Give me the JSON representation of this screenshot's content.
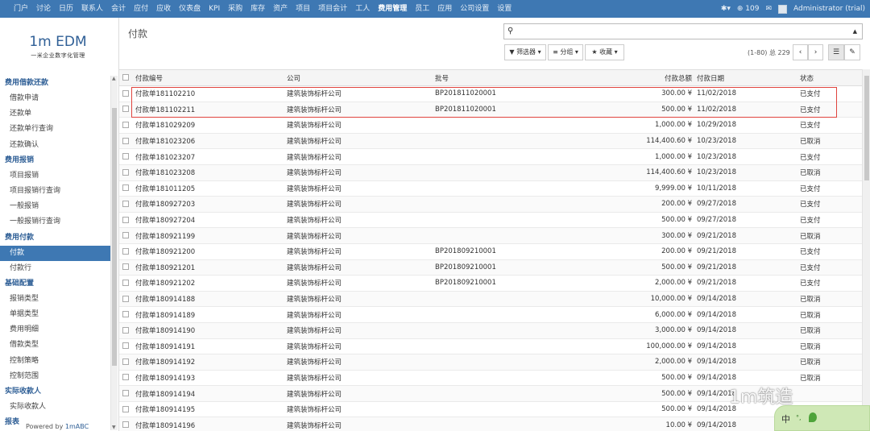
{
  "topnav": {
    "items": [
      "门户",
      "讨论",
      "日历",
      "联系人",
      "会计",
      "应付",
      "应收",
      "仪表盘",
      "KPI",
      "采购",
      "库存",
      "资产",
      "项目",
      "项目会计",
      "工人",
      "费用管理",
      "员工",
      "应用",
      "公司设置",
      "设置"
    ],
    "active": "费用管理"
  },
  "topright": {
    "bug_icon": "bug-icon",
    "count": "109",
    "user": "Administrator (trial)"
  },
  "logo": {
    "main": "1m EDM",
    "sub": "一米企业数字化管理"
  },
  "sidebar": {
    "sections": [
      {
        "title": "费用借款还款",
        "items": [
          "借款申请",
          "还款单",
          "还款单行查询",
          "还款确认"
        ]
      },
      {
        "title": "费用报销",
        "items": [
          "项目报销",
          "项目报销行查询",
          "一般报销",
          "一般报销行查询"
        ]
      },
      {
        "title": "费用付款",
        "items": [
          "付款",
          "付款行"
        ]
      },
      {
        "title": "基础配置",
        "items": [
          "报销类型",
          "单据类型",
          "费用明细",
          "借款类型",
          "控制策略",
          "控制范围"
        ]
      },
      {
        "title": "实际收款人",
        "items": [
          "实际收款人"
        ]
      },
      {
        "title": "报表",
        "items": []
      }
    ],
    "active_item": "付款",
    "powered_prefix": "Powered by ",
    "powered_brand": "1mABC"
  },
  "page": {
    "title": "付款",
    "filters_label": "筛选器",
    "group_label": "分组",
    "favorites_label": "收藏",
    "pager_text": "(1-80) 总 229",
    "prev": "‹",
    "next": "›"
  },
  "table": {
    "headers": [
      "付款编号",
      "公司",
      "批号",
      "付款总额",
      "付款日期",
      "状态"
    ],
    "rows": [
      [
        "付款单181102210",
        "建筑装饰标杆公司",
        "BP201811020001",
        "300.00 ¥",
        "11/02/2018",
        "已支付"
      ],
      [
        "付款单181102211",
        "建筑装饰标杆公司",
        "BP201811020001",
        "500.00 ¥",
        "11/02/2018",
        "已支付"
      ],
      [
        "付款单181029209",
        "建筑装饰标杆公司",
        "",
        "1,000.00 ¥",
        "10/29/2018",
        "已支付"
      ],
      [
        "付款单181023206",
        "建筑装饰标杆公司",
        "",
        "114,400.60 ¥",
        "10/23/2018",
        "已取消"
      ],
      [
        "付款单181023207",
        "建筑装饰标杆公司",
        "",
        "1,000.00 ¥",
        "10/23/2018",
        "已支付"
      ],
      [
        "付款单181023208",
        "建筑装饰标杆公司",
        "",
        "114,400.60 ¥",
        "10/23/2018",
        "已取消"
      ],
      [
        "付款单181011205",
        "建筑装饰标杆公司",
        "",
        "9,999.00 ¥",
        "10/11/2018",
        "已支付"
      ],
      [
        "付款单180927203",
        "建筑装饰标杆公司",
        "",
        "200.00 ¥",
        "09/27/2018",
        "已支付"
      ],
      [
        "付款单180927204",
        "建筑装饰标杆公司",
        "",
        "500.00 ¥",
        "09/27/2018",
        "已支付"
      ],
      [
        "付款单180921199",
        "建筑装饰标杆公司",
        "",
        "300.00 ¥",
        "09/21/2018",
        "已取消"
      ],
      [
        "付款单180921200",
        "建筑装饰标杆公司",
        "BP201809210001",
        "200.00 ¥",
        "09/21/2018",
        "已支付"
      ],
      [
        "付款单180921201",
        "建筑装饰标杆公司",
        "BP201809210001",
        "500.00 ¥",
        "09/21/2018",
        "已支付"
      ],
      [
        "付款单180921202",
        "建筑装饰标杆公司",
        "BP201809210001",
        "2,000.00 ¥",
        "09/21/2018",
        "已支付"
      ],
      [
        "付款单180914188",
        "建筑装饰标杆公司",
        "",
        "10,000.00 ¥",
        "09/14/2018",
        "已取消"
      ],
      [
        "付款单180914189",
        "建筑装饰标杆公司",
        "",
        "6,000.00 ¥",
        "09/14/2018",
        "已取消"
      ],
      [
        "付款单180914190",
        "建筑装饰标杆公司",
        "",
        "3,000.00 ¥",
        "09/14/2018",
        "已取消"
      ],
      [
        "付款单180914191",
        "建筑装饰标杆公司",
        "",
        "100,000.00 ¥",
        "09/14/2018",
        "已取消"
      ],
      [
        "付款单180914192",
        "建筑装饰标杆公司",
        "",
        "2,000.00 ¥",
        "09/14/2018",
        "已取消"
      ],
      [
        "付款单180914193",
        "建筑装饰标杆公司",
        "",
        "500.00 ¥",
        "09/14/2018",
        "已取消"
      ],
      [
        "付款单180914194",
        "建筑装饰标杆公司",
        "",
        "500.00 ¥",
        "09/14/2018",
        ""
      ],
      [
        "付款单180914195",
        "建筑装饰标杆公司",
        "",
        "500.00 ¥",
        "09/14/2018",
        ""
      ],
      [
        "付款单180914196",
        "建筑装饰标杆公司",
        "",
        "10.00 ¥",
        "09/14/2018",
        ""
      ]
    ]
  },
  "watermark": "1m筑造",
  "ime": {
    "lang": "中",
    "dot": "°,"
  }
}
